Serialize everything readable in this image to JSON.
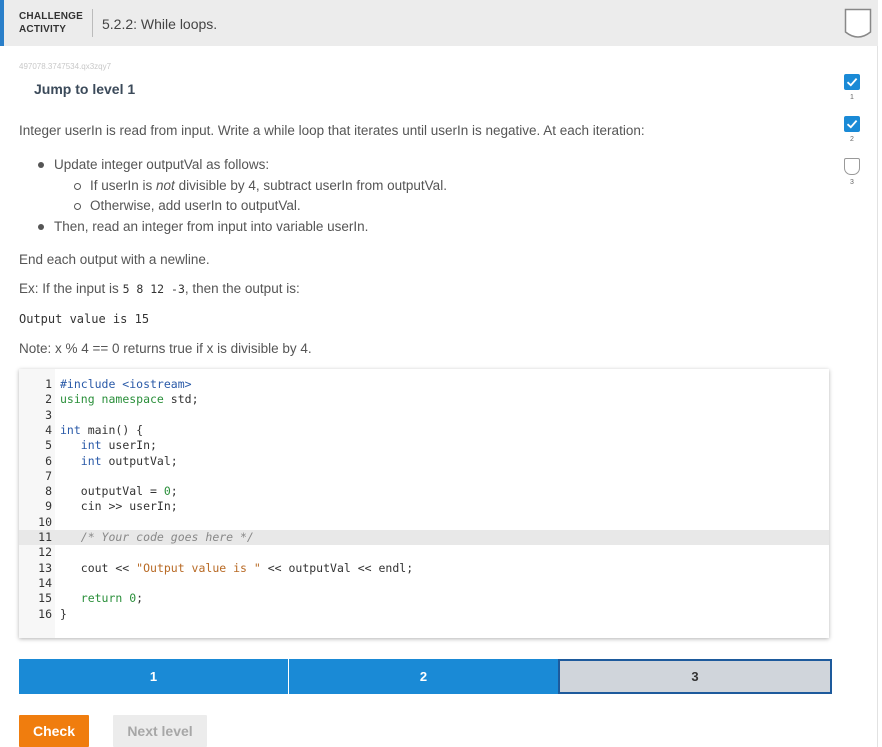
{
  "header": {
    "kind": "CHALLENGE ACTIVITY",
    "title": "5.2.2: While loops."
  },
  "code_id": "497078.3747534.qx3zqy7",
  "jump_label": "Jump to level 1",
  "levels_side": [
    {
      "num": "1",
      "state": "done"
    },
    {
      "num": "2",
      "state": "done"
    },
    {
      "num": "3",
      "state": "todo"
    }
  ],
  "instructions": {
    "intro": "Integer userIn is read from input. Write a while loop that iterates until userIn is negative. At each iteration:",
    "bullet1": "Update integer outputVal as follows:",
    "sub1_pre": "If userIn is ",
    "sub1_em": "not",
    "sub1_post": " divisible by 4, subtract userIn from outputVal.",
    "sub2": "Otherwise, add userIn to outputVal.",
    "bullet2": "Then, read an integer from input into variable userIn.",
    "end_each": "End each output with a newline.",
    "ex_pre": "Ex: If the input is ",
    "ex_input": "5 8 12 -3",
    "ex_post": ", then the output is:",
    "output": "Output value is 15",
    "note": "Note: x % 4 == 0 returns true if x is divisible by 4."
  },
  "code": {
    "l1": "#include <iostream>",
    "l2a": "using",
    "l2b": " namespace",
    "l2c": " std;",
    "l4a": "int",
    "l4b": " main() {",
    "l5a": "   int",
    "l5b": " userIn;",
    "l6a": "   int",
    "l6b": " outputVal;",
    "l8a": "   outputVal = ",
    "l8b": "0",
    "l8c": ";",
    "l9": "   cin >> userIn;",
    "l11": "   /* Your code goes here */",
    "l13a": "   cout << ",
    "l13b": "\"Output value is \"",
    "l13c": " << outputVal << endl;",
    "l15a": "   return",
    "l15b": " 0",
    "l15c": ";",
    "l16": "}"
  },
  "progress": [
    {
      "label": "1",
      "state": "done"
    },
    {
      "label": "2",
      "state": "done"
    },
    {
      "label": "3",
      "state": "current"
    }
  ],
  "buttons": {
    "check": "Check",
    "next": "Next level"
  },
  "colors": {
    "accent": "#1a8ad6",
    "check_button": "#f07d0e",
    "current_level_border": "#1d5a9c"
  }
}
